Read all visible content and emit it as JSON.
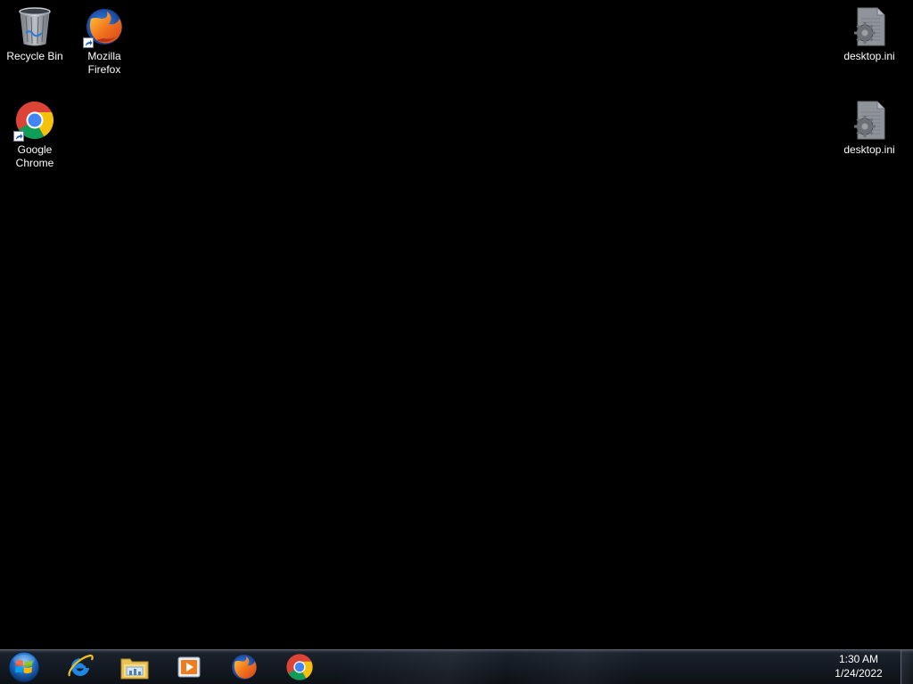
{
  "desktop": {
    "icons": [
      {
        "label": "Recycle Bin",
        "icon": "recycle-bin-icon",
        "shortcut": false
      },
      {
        "label": "Mozilla\nFirefox",
        "icon": "firefox-icon",
        "shortcut": true
      },
      {
        "label": "Google\nChrome",
        "icon": "chrome-icon",
        "shortcut": true
      },
      {
        "label": "desktop.ini",
        "icon": "settings-file-icon",
        "shortcut": false
      },
      {
        "label": "desktop.ini",
        "icon": "settings-file-icon",
        "shortcut": false
      }
    ]
  },
  "taskbar": {
    "start": {
      "icon": "windows-start-orb-icon"
    },
    "pinned": [
      {
        "icon": "internet-explorer-icon"
      },
      {
        "icon": "windows-explorer-icon"
      },
      {
        "icon": "windows-media-player-icon"
      },
      {
        "icon": "firefox-icon"
      },
      {
        "icon": "chrome-icon"
      }
    ],
    "clock": {
      "time": "1:30 AM",
      "date": "1/24/2022"
    }
  },
  "colors": {
    "desktop_background": "#000000",
    "taskbar_background": "#141a22",
    "label_text": "#ffffff"
  }
}
